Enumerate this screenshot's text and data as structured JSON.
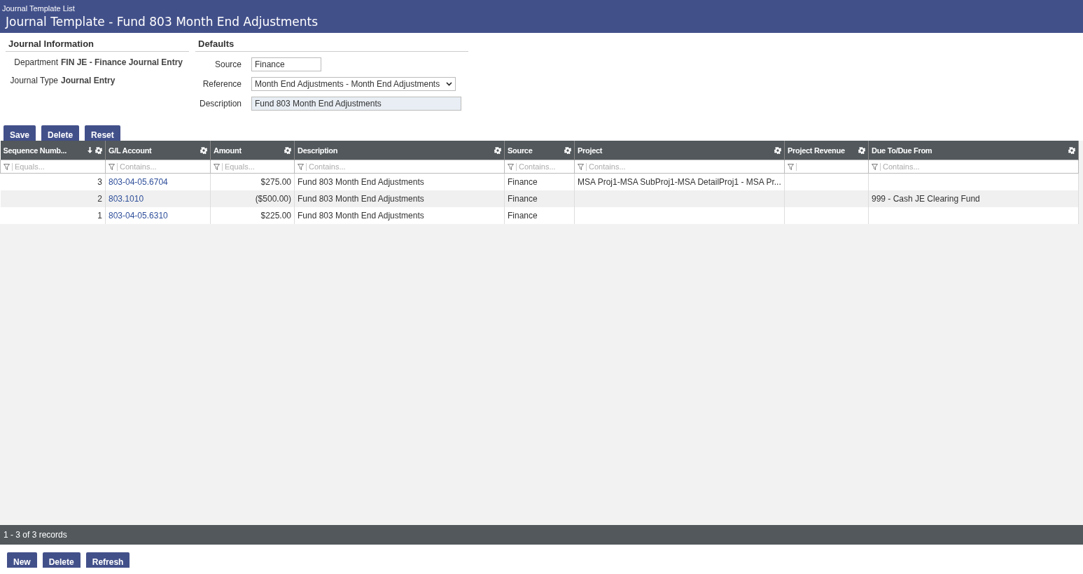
{
  "breadcrumb": "Journal Template List",
  "title": "Journal Template - Fund 803 Month End Adjustments",
  "journal_information": {
    "heading": "Journal Information",
    "fields": [
      {
        "label": "Department",
        "value": "FIN JE - Finance Journal Entry"
      },
      {
        "label": "Journal Type",
        "value": "Journal Entry"
      }
    ]
  },
  "defaults": {
    "heading": "Defaults",
    "fields": [
      {
        "label": "Source",
        "kind": "text",
        "value": "Finance"
      },
      {
        "label": "Reference",
        "kind": "select",
        "value": "Month End Adjustments - Month End Adjustments"
      },
      {
        "label": "Description",
        "kind": "readonly",
        "value": "Fund 803 Month End Adjustments"
      }
    ]
  },
  "form_buttons": [
    "Save",
    "Delete",
    "Reset"
  ],
  "grid": {
    "columns": [
      {
        "label": "Sequence Numb...",
        "kind": "number",
        "sorted": true,
        "filter_placeholder": "Equals..."
      },
      {
        "label": "G/L Account",
        "kind": "link",
        "sorted": false,
        "filter_placeholder": "Contains..."
      },
      {
        "label": "Amount",
        "kind": "number",
        "sorted": false,
        "filter_placeholder": "Equals..."
      },
      {
        "label": "Description",
        "kind": "text",
        "sorted": false,
        "filter_placeholder": "Contains..."
      },
      {
        "label": "Source",
        "kind": "text",
        "sorted": false,
        "filter_placeholder": "Contains..."
      },
      {
        "label": "Project",
        "kind": "text",
        "sorted": false,
        "filter_placeholder": "Contains..."
      },
      {
        "label": "Project Revenue",
        "kind": "text",
        "sorted": false
      },
      {
        "label": "Due To/Due From",
        "kind": "text",
        "sorted": false,
        "filter_placeholder": "Contains..."
      }
    ],
    "rows": [
      {
        "cells": [
          "3",
          "803-04-05.6704",
          "$275.00",
          "Fund 803 Month End Adjustments",
          "Finance",
          "MSA Proj1-MSA SubProj1-MSA DetailProj1 - MSA Pr...",
          null,
          null
        ]
      },
      {
        "cells": [
          "2",
          "803.1010",
          "($500.00)",
          "Fund 803 Month End Adjustments",
          "Finance",
          null,
          null,
          "999 - Cash JE Clearing Fund"
        ]
      },
      {
        "cells": [
          "1",
          "803-04-05.6310",
          "$225.00",
          "Fund 803 Month End Adjustments",
          "Finance",
          null,
          null,
          null
        ]
      }
    ],
    "footer": "1 - 3 of 3 records"
  },
  "grid_buttons": [
    "New",
    "Delete",
    "Refresh"
  ]
}
